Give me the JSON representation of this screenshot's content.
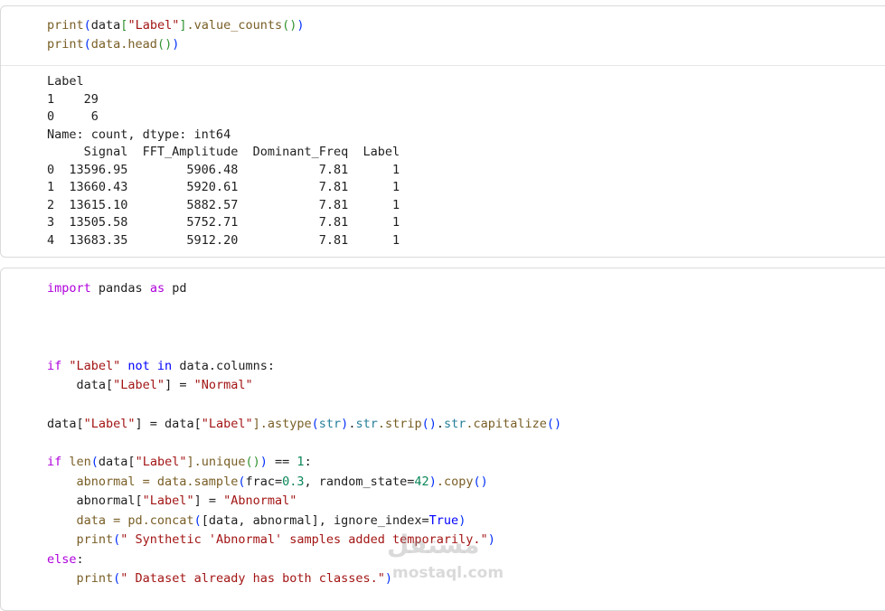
{
  "cell1": {
    "code": {
      "line1": {
        "a": "print",
        "b": "(",
        "c": "data",
        "d": "[",
        "e": "\"Label\"",
        "f": "]",
        "g": ".value_counts",
        "h": "()",
        "i": ")"
      },
      "line2": {
        "a": "print",
        "b": "(",
        "c": "data.head",
        "d": "()",
        "e": ")"
      }
    },
    "output": {
      "lines": [
        "Label",
        "1    29",
        "0     6",
        "Name: count, dtype: int64"
      ],
      "df_header": "     Signal  FFT_Amplitude  Dominant_Freq  Label",
      "df_rows": [
        "0  13596.95        5906.48           7.81      1",
        "1  13660.43        5920.61           7.81      1",
        "2  13615.10        5882.57           7.81      1",
        "3  13505.58        5752.71           7.81      1",
        "4  13683.35        5912.20           7.81      1"
      ]
    }
  },
  "cell2": {
    "l1": {
      "kw": "import",
      "rest": " pandas ",
      "kw2": "as",
      "end": " pd"
    },
    "l2": {
      "kw": "if",
      "s": " \"Label\" ",
      "kw2": "not in",
      "rest": " data.columns:"
    },
    "l3": {
      "pre": "    data[",
      "s": "\"Label\"",
      "mid": "] = ",
      "s2": "\"Normal\""
    },
    "l4": {
      "a": "data[",
      "s": "\"Label\"",
      "b": "] = data[",
      "s2": "\"Label\"",
      "c": "].astype",
      "p1": "(",
      "bi": "str",
      "p1c": ")",
      ".d": "",
      "d": ".",
      "bi2": "str",
      "e": ".strip",
      "p2": "()",
      "f": ".",
      "bi3": "str",
      "g": ".capitalize",
      "p3": "()"
    },
    "l5": {
      "kw": "if",
      "fn": " len",
      "p": "(",
      "a": "data[",
      "s": "\"Label\"",
      "b": "].unique",
      "p2": "()",
      "pc": ")",
      "c": " == ",
      "n": "1",
      ":": ":"
    },
    "l6": {
      "a": "    abnormal = data.sample",
      "p": "(",
      "b": "frac=",
      "n1": "0.3",
      "c": ", random_state=",
      "n2": "42",
      "pc": ")",
      "d": ".copy",
      "p2": "()"
    },
    "l7": {
      "a": "    abnormal[",
      "s": "\"Abnormal\"",
      "s0": "\"Label\"",
      "b": "] = "
    },
    "l8": {
      "a": "    data = pd.concat",
      "p": "(",
      "b": "[data, abnormal], ignore_index=",
      "kw": "True",
      "pc": ")"
    },
    "l9": {
      "a": "    print",
      "p": "(",
      "s": "\" Synthetic 'Abnormal' samples added temporarily.\"",
      "pc": ")"
    },
    "l10": {
      "kw": "else",
      ":": ":"
    },
    "l11": {
      "a": "    print",
      "p": "(",
      "s": "\" Dataset already has both classes.\"",
      "pc": ")"
    }
  },
  "watermark": {
    "text": "مستقل",
    "sub": "mostaql.com"
  }
}
